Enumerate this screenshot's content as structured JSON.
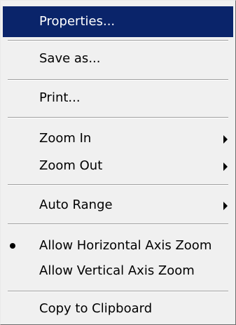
{
  "menu": {
    "items": [
      {
        "label": "Properties..."
      },
      {
        "label": "Save as..."
      },
      {
        "label": "Print..."
      },
      {
        "label": "Zoom In"
      },
      {
        "label": "Zoom Out"
      },
      {
        "label": "Auto Range"
      },
      {
        "label": "Allow Horizontal Axis Zoom"
      },
      {
        "label": "Allow Vertical Axis Zoom"
      },
      {
        "label": "Copy to Clipboard"
      }
    ]
  },
  "colors": {
    "highlight_bg": "#0a246a",
    "highlight_text": "#ffffff",
    "menu_bg": "#f0f0f0"
  },
  "icons": {
    "submenu": "chevron-right-icon",
    "checked": "radio-dot-icon"
  }
}
